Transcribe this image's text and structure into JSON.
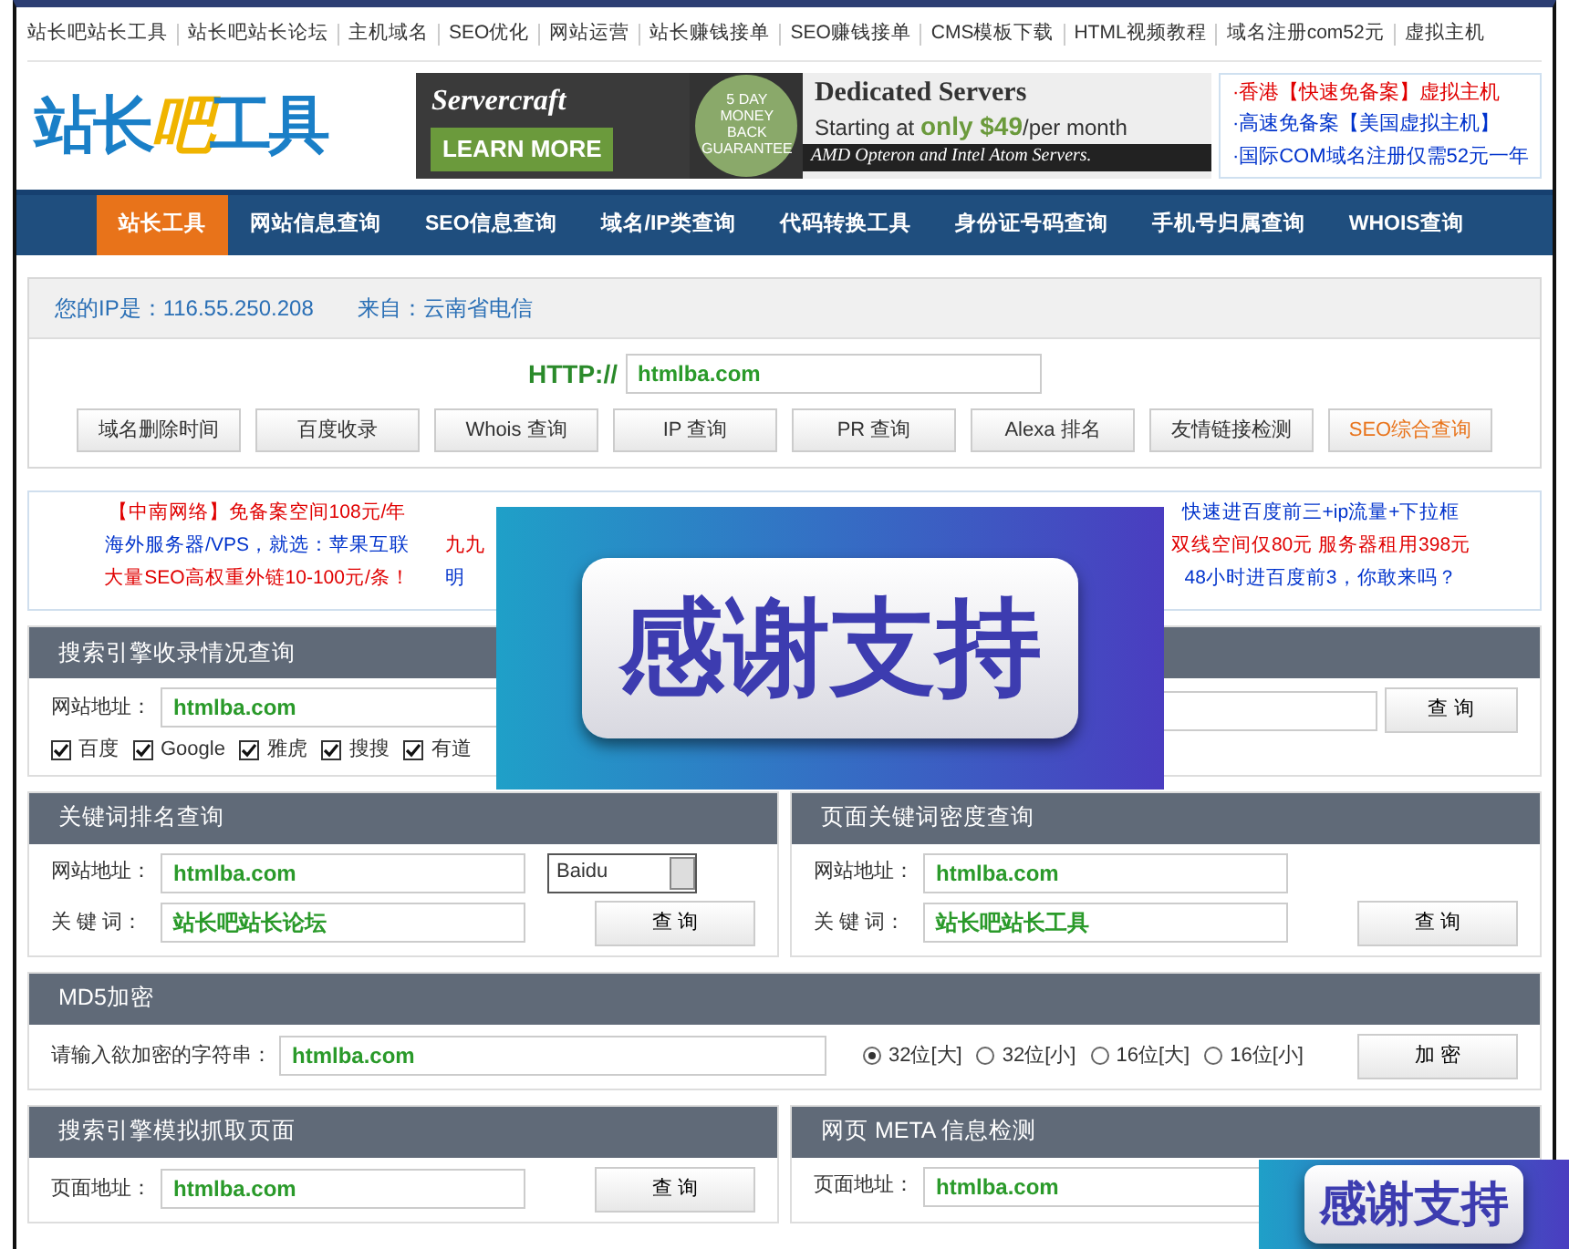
{
  "top_links": [
    "站长吧站长工具",
    "站长吧站长论坛",
    "主机域名",
    "SEO优化",
    "网站运营",
    "站长赚钱接单",
    "SEO赚钱接单",
    "CMS模板下载",
    "HTML视频教程",
    "域名注册com52元",
    "虚拟主机"
  ],
  "logo": {
    "part_1": "站长",
    "part_2": "吧",
    "part_3": "工具"
  },
  "banner_ad": {
    "brand": "Servercraft",
    "button": "LEARN MORE",
    "badge": "5 DAY MONEY BACK GUARANTEE",
    "title": "Dedicated Servers",
    "offer_1": "Starting at",
    "offer_2": "only $49",
    "offer_3": "/per month",
    "footer": "AMD Opteron and Intel Atom Servers."
  },
  "side_links": [
    {
      "text": "·香港【快速免备案】虚拟主机",
      "color": "#e00000"
    },
    {
      "text": "·高速免备案【美国虚拟主机】",
      "color": "#0033cc"
    },
    {
      "text": "·国际COM域名注册仅需52元一年",
      "color": "#0033cc"
    }
  ],
  "nav": [
    {
      "label": "站长工具",
      "selected": true
    },
    {
      "label": "网站信息查询",
      "selected": false
    },
    {
      "label": "SEO信息查询",
      "selected": false
    },
    {
      "label": "域名/IP类查询",
      "selected": false
    },
    {
      "label": "代码转换工具",
      "selected": false
    },
    {
      "label": "身份证号码查询",
      "selected": false
    },
    {
      "label": "手机号归属查询",
      "selected": false
    },
    {
      "label": "WHOIS查询",
      "selected": false
    }
  ],
  "ip_bar": {
    "ip": "您的IP是：116.55.250.208",
    "origin": "来自：云南省电信"
  },
  "http_field": {
    "prefix": "HTTP://",
    "value": "htmlba.com"
  },
  "quick_buttons": [
    {
      "label": "域名删除时间",
      "highlight": false
    },
    {
      "label": "百度收录",
      "highlight": false
    },
    {
      "label": "Whois 查询",
      "highlight": false
    },
    {
      "label": "IP 查询",
      "highlight": false
    },
    {
      "label": "PR 查询",
      "highlight": false
    },
    {
      "label": "Alexa 排名",
      "highlight": false
    },
    {
      "label": "友情链接检测",
      "highlight": false
    },
    {
      "label": "SEO综合查询",
      "highlight": true
    }
  ],
  "text_ads": [
    [
      {
        "text": "【中南网络】免备案空间108元/年",
        "color": "#e00000"
      },
      {
        "text": "海外服务器/VPS，就选：苹果互联",
        "color": "#0033cc"
      },
      {
        "text": "大量SEO高权重外链10-100元/条！",
        "color": "#e00000"
      }
    ],
    [
      {
        "text": "九九",
        "color": "#e00000"
      },
      {
        "text": "明",
        "color": "#0033cc"
      }
    ],
    [
      {
        "text": "快速进百度前三+ip流量+下拉框",
        "color": "#0033cc"
      },
      {
        "text": "双线空间仅80元 服务器租用398元",
        "color": "#e00000"
      },
      {
        "text": "48小时进百度前3，你敢来吗？",
        "color": "#0033cc"
      }
    ]
  ],
  "panels": [
    {
      "title": "搜索引擎收录情况查询",
      "half": true,
      "fields": [
        {
          "label": "网站地址：",
          "value": "htmlba.com"
        }
      ],
      "checks": [
        {
          "label": "百度",
          "checked": true
        },
        {
          "label": "Google",
          "checked": true
        },
        {
          "label": "雅虎",
          "checked": true
        },
        {
          "label": "搜搜",
          "checked": true
        },
        {
          "label": "有道",
          "checked": true
        }
      ]
    },
    {
      "half": true,
      "button": "查 询"
    },
    {
      "title": "关键词排名查询",
      "half": true,
      "fields": [
        {
          "label": "网站地址：",
          "value": "htmlba.com",
          "select": "Baidu"
        },
        {
          "label": "关 键 词：",
          "value": "站长吧站长论坛"
        }
      ],
      "button": "查 询"
    },
    {
      "title": "页面关键词密度查询",
      "half": true,
      "fields": [
        {
          "label": "网站地址：",
          "value": "htmlba.com"
        },
        {
          "label": "关 键 词：",
          "value": "站长吧站长工具"
        }
      ],
      "button": "查 询"
    },
    {
      "title": "MD5加密",
      "half": false,
      "fields": [
        {
          "label": "请输入欲加密的字符串：",
          "value": "htmlba.com"
        }
      ],
      "radios": [
        {
          "label": "32位[大]",
          "selected": true
        },
        {
          "label": "32位[小]",
          "selected": false
        },
        {
          "label": "16位[大]",
          "selected": false
        },
        {
          "label": "16位[小]",
          "selected": false
        }
      ],
      "button": "加 密"
    },
    {
      "title": "搜索引擎模拟抓取页面",
      "half": true,
      "fields": [
        {
          "label": "页面地址：",
          "value": "htmlba.com"
        }
      ],
      "button": "查 询"
    },
    {
      "title": "网页 META 信息检测",
      "half": true,
      "fields": [
        {
          "label": "页面地址：",
          "value": "htmlba.com"
        }
      ]
    }
  ],
  "overlays": [
    {
      "text": "感谢支持"
    },
    {
      "text": "感谢支持"
    }
  ]
}
